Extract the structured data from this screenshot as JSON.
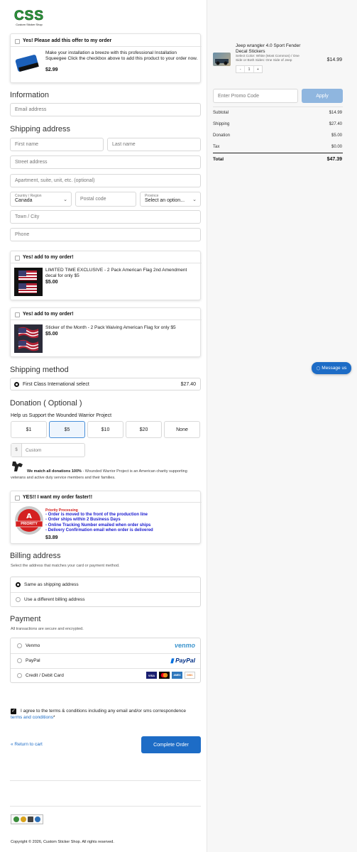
{
  "brand": {
    "logo_text": "CSS",
    "logo_sub": "Custom Sticker Shop"
  },
  "offer_top": {
    "checkbox_label": "Yes! Please add this offer to my order",
    "description": "Make your installation a breeze with this professional Installation Squeegee Click the checkbox above to add this product to your order now.",
    "price": "$2.99"
  },
  "information": {
    "title": "Information",
    "email_placeholder": "Email address"
  },
  "shipping_address": {
    "title": "Shipping address",
    "first_name": "First name",
    "last_name": "Last name",
    "street": "Street address",
    "apartment": "Apartment, suite, unit, etc. (optional)",
    "country_label": "Country / Region",
    "country_value": "Canada",
    "postal": "Postal code",
    "province_label": "Province",
    "province_value": "Select an option...",
    "town": "Town / City",
    "phone": "Phone"
  },
  "offer_flag_1": {
    "checkbox_label": "Yes! add to my order!",
    "description": "LIMITED TIME EXCLUSIVE - 2 Pack American Flag 2nd Amendment decal for only $5",
    "price": "$5.00"
  },
  "offer_flag_2": {
    "checkbox_label": "Yes! add to my order!",
    "description": "Sticker of the Month - 2 Pack Waiving American Flag for only $5",
    "price": "$5.00"
  },
  "shipping_method": {
    "title": "Shipping method",
    "option": "First Class International select",
    "price": "$27.40"
  },
  "donation": {
    "title": "Donation ( Optional )",
    "subtitle": "Help us Support the Wounded Warrior Project",
    "amounts": [
      "$1",
      "$5",
      "$10",
      "$20",
      "None"
    ],
    "currency": "$",
    "custom_placeholder": "Custom",
    "note_bold": "We match all donations 100%",
    "note_rest": " - Wounded Warrior Project is an American charity supporting veterans and active duty service members and their families."
  },
  "priority": {
    "checkbox_label": "YES!! I want my order faster!!",
    "badge_text": "PRIORITY",
    "heading": "Priority Processing",
    "lines": [
      "- Order is moved to the front of the production line",
      "- Order ships within 2 Business Days",
      "- Online Tracking Number emailed when order ships",
      "- Delivery Confirmation email when order is delivered"
    ],
    "price": "$3.89"
  },
  "billing": {
    "title": "Billing address",
    "subtitle": "Select the address that matches your card or payment method.",
    "options": [
      "Same as shipping address",
      "Use a different billing address"
    ]
  },
  "payment": {
    "title": "Payment",
    "subtitle": "All transactions are secure and encrypted.",
    "options": [
      "Venmo",
      "PayPal",
      "Credit / Debit Card"
    ],
    "venmo_logo": "venmo",
    "paypal_logo": "PayPal",
    "cards": [
      "VISA",
      "MC",
      "AMEX",
      "DISC"
    ]
  },
  "terms": {
    "text": "I agree to the terms & conditions including any email and/or sms correspondence ",
    "link": "terms and conditions",
    "asterisk": "*"
  },
  "actions": {
    "return": "« Return to cart",
    "complete": "Complete Order"
  },
  "footer": {
    "copyright": "Copyright © 2026, Custom Sticker Shop. All rights reserved."
  },
  "cart": {
    "item_title": "Jeep wrangler 4.0 Sport Fender Decal Stickers",
    "item_options": "Select Color: White (Most Common) / One Side or Both Sides: One Side of Jeep",
    "qty": "1",
    "minus": "-",
    "plus": "+",
    "item_price": "$14.99",
    "promo_placeholder": "Enter Promo Code",
    "apply": "Apply",
    "rows": [
      {
        "label": "Subtotal",
        "value": "$14.99"
      },
      {
        "label": "Shipping",
        "value": "$27.40"
      },
      {
        "label": "Donation",
        "value": "$5.00"
      },
      {
        "label": "Tax",
        "value": "$0.00"
      }
    ],
    "total_label": "Total",
    "total_value": "$47.39"
  },
  "chat": {
    "label": "Message us"
  },
  "colors": {
    "accent": "#1d6cc6",
    "apply": "#8fb6df",
    "logo_green": "#2e9a3e",
    "priority_red": "#d42020",
    "priority_blue": "#1a1acf"
  }
}
